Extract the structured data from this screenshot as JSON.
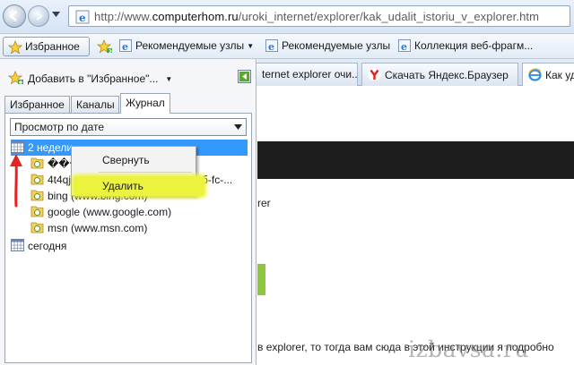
{
  "address_bar": {
    "url_prefix": "http://www.",
    "url_domain": "computerhom.ru",
    "url_path": "/uroki_internet/explorer/kak_udalit_istoriu_v_explorer.htm"
  },
  "favorites_bar": {
    "favorites_button": "Избранное",
    "items": [
      {
        "label": "Рекомендуемые узлы",
        "icon": "ie-page-icon",
        "has_caret": true
      },
      {
        "label": "Рекомендуемые узлы",
        "icon": "ie-page-icon"
      },
      {
        "label": "Коллекция веб-фрагм...",
        "icon": "ie-page-icon"
      }
    ]
  },
  "favorites_center": {
    "add_to_favorites": "Добавить в \"Избранное\"...",
    "tabs": [
      {
        "label": "Избранное"
      },
      {
        "label": "Каналы"
      },
      {
        "label": "Журнал",
        "active": true
      }
    ],
    "view_select": {
      "value": "Просмотр по дате"
    },
    "tree": [
      {
        "label": "2 недели",
        "icon": "calendar-icon",
        "selected": true,
        "level": 0
      },
      {
        "label": "����",
        "icon": "folder-page-icon",
        "level": 1
      },
      {
        "label": "4t4qj",
        "label_tail": "б-fc-...",
        "icon": "folder-page-icon",
        "level": 1
      },
      {
        "label": "bing (www.bing.com)",
        "icon": "folder-page-icon",
        "level": 1
      },
      {
        "label": "google (www.google.com)",
        "icon": "folder-page-icon",
        "level": 1
      },
      {
        "label": "msn (www.msn.com)",
        "icon": "folder-page-icon",
        "level": 1
      },
      {
        "label": "сегодня",
        "icon": "calendar-icon",
        "level": 0
      }
    ]
  },
  "context_menu": {
    "items": [
      {
        "label": "Свернуть"
      },
      {
        "label": "Удалить",
        "highlighted": true
      }
    ]
  },
  "browser_tabs": [
    {
      "label": "ternet explorer очи...",
      "icon": "ie-page-icon"
    },
    {
      "label": "Скачать Яндекс.Браузер",
      "icon": "yandex-icon"
    },
    {
      "label": "Как уда",
      "icon": "ie-page-icon",
      "selected": true
    }
  ],
  "page_content": {
    "line1": "rer",
    "line2": "в explorer, то тогда вам сюда в этой инструкции я подробно"
  },
  "watermark": "izbavsa.ru",
  "colors": {
    "selection": "#3399ff",
    "highlight": "#ecf33f",
    "annotation_arrow": "#e8231f",
    "green_accent": "#8dc63f"
  }
}
